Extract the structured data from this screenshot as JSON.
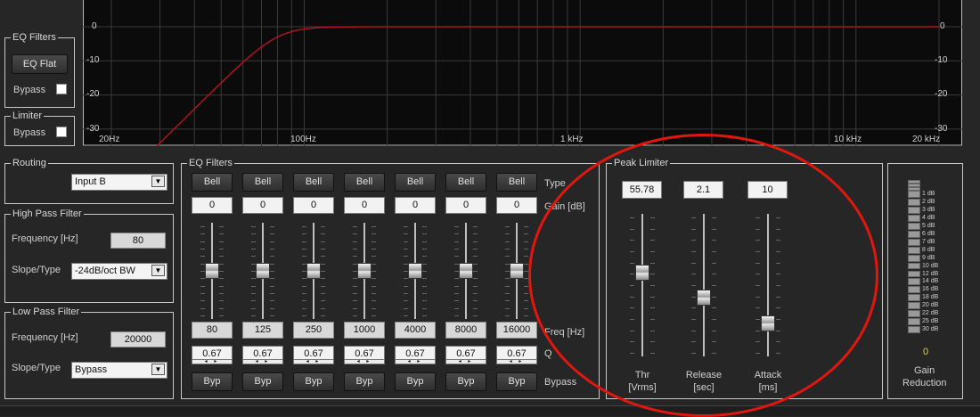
{
  "graph": {
    "y_ticks": [
      "0",
      "-10",
      "-20",
      "-30"
    ],
    "x_ticks": [
      "20Hz",
      "100Hz",
      "1 kHz",
      "10 kHz",
      "20 kHz"
    ],
    "curve_color": "#b01222"
  },
  "eq_filters_side": {
    "title": "EQ Filters",
    "eq_flat_label": "EQ Flat",
    "bypass_label": "Bypass"
  },
  "limiter_side": {
    "title": "Limiter",
    "bypass_label": "Bypass"
  },
  "routing": {
    "title": "Routing",
    "selected": "Input B"
  },
  "high_pass": {
    "title": "High Pass Filter",
    "freq_label": "Frequency [Hz]",
    "freq_value": "80",
    "slope_label": "Slope/Type",
    "slope_selected": "-24dB/oct BW"
  },
  "low_pass": {
    "title": "Low Pass Filter",
    "freq_label": "Frequency [Hz]",
    "freq_value": "20000",
    "slope_label": "Slope/Type",
    "slope_selected": "Bypass"
  },
  "eq_bands": {
    "title": "EQ Filters",
    "row_labels": {
      "type": "Type",
      "gain": "Gain [dB]",
      "freq": "Freq [Hz]",
      "q": "Q",
      "bypass": "Bypass"
    },
    "bands": [
      {
        "type": "Bell",
        "gain": "0",
        "freq": "80",
        "q": "0.67",
        "byp": "Byp",
        "level": 0.5
      },
      {
        "type": "Bell",
        "gain": "0",
        "freq": "125",
        "q": "0.67",
        "byp": "Byp",
        "level": 0.5
      },
      {
        "type": "Bell",
        "gain": "0",
        "freq": "250",
        "q": "0.67",
        "byp": "Byp",
        "level": 0.5
      },
      {
        "type": "Bell",
        "gain": "0",
        "freq": "1000",
        "q": "0.67",
        "byp": "Byp",
        "level": 0.5
      },
      {
        "type": "Bell",
        "gain": "0",
        "freq": "4000",
        "q": "0.67",
        "byp": "Byp",
        "level": 0.5
      },
      {
        "type": "Bell",
        "gain": "0",
        "freq": "8000",
        "q": "0.67",
        "byp": "Byp",
        "level": 0.5
      },
      {
        "type": "Bell",
        "gain": "0",
        "freq": "16000",
        "q": "0.67",
        "byp": "Byp",
        "level": 0.5
      }
    ]
  },
  "peak_limiter": {
    "title": "Peak Limiter",
    "controls": [
      {
        "value": "55.78",
        "label1": "Thr",
        "label2": "[Vrms]",
        "level": 0.6
      },
      {
        "value": "2.1",
        "label1": "Release",
        "label2": "[sec]",
        "level": 0.4
      },
      {
        "value": "10",
        "label1": "Attack",
        "label2": "[ms]",
        "level": 0.2
      }
    ]
  },
  "gain_reduction": {
    "scale": [
      "1 dB",
      "2 dB",
      "3 dB",
      "4 dB",
      "5 dB",
      "6 dB",
      "7 dB",
      "8 dB",
      "9 dB",
      "10 dB",
      "12 dB",
      "14 dB",
      "16 dB",
      "18 dB",
      "20 dB",
      "22 dB",
      "25 dB",
      "30 dB"
    ],
    "value": "0",
    "value_color": "#d6d63a",
    "label1": "Gain",
    "label2": "Reduction"
  },
  "highlight_color": "#e0170f"
}
